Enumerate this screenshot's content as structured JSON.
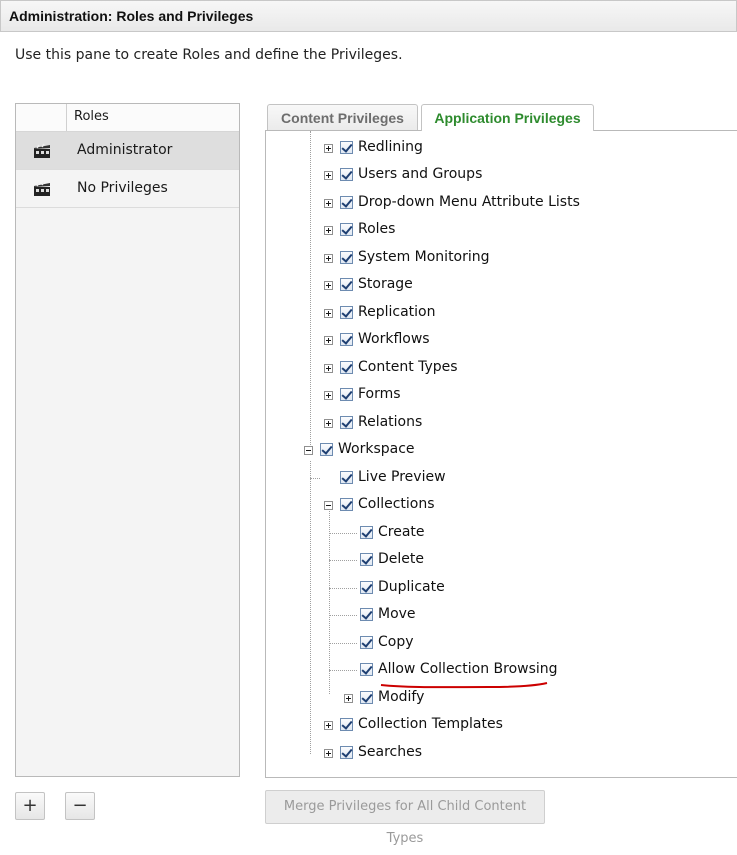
{
  "window": {
    "title": "Administration: Roles and Privileges"
  },
  "description": "Use this pane to create Roles and define the Privileges.",
  "roles": {
    "header": "Roles",
    "items": [
      {
        "label": "Administrator",
        "selected": true,
        "icon": "clapperboard-icon"
      },
      {
        "label": "No Privileges",
        "selected": false,
        "icon": "clapperboard-icon"
      }
    ]
  },
  "tabs": [
    {
      "label": "Content Privileges",
      "active": false
    },
    {
      "label": "Application Privileges",
      "active": true
    }
  ],
  "tree": {
    "items": [
      {
        "label": "Redlining",
        "level": 2,
        "expander": "plus",
        "checked": true
      },
      {
        "label": "Users and Groups",
        "level": 2,
        "expander": "plus",
        "checked": true
      },
      {
        "label": "Drop-down Menu Attribute Lists",
        "level": 2,
        "expander": "plus",
        "checked": true
      },
      {
        "label": "Roles",
        "level": 2,
        "expander": "plus",
        "checked": true
      },
      {
        "label": "System Monitoring",
        "level": 2,
        "expander": "plus",
        "checked": true
      },
      {
        "label": "Storage",
        "level": 2,
        "expander": "plus",
        "checked": true
      },
      {
        "label": "Replication",
        "level": 2,
        "expander": "plus",
        "checked": true
      },
      {
        "label": "Workflows",
        "level": 2,
        "expander": "plus",
        "checked": true
      },
      {
        "label": "Content Types",
        "level": 2,
        "expander": "plus",
        "checked": true
      },
      {
        "label": "Forms",
        "level": 2,
        "expander": "plus",
        "checked": true
      },
      {
        "label": "Relations",
        "level": 2,
        "expander": "plus",
        "checked": true
      },
      {
        "label": "Workspace",
        "level": 1,
        "expander": "minus",
        "checked": true
      },
      {
        "label": "Live Preview",
        "level": 2,
        "expander": "none",
        "checked": true
      },
      {
        "label": "Collections",
        "level": 2,
        "expander": "minus",
        "checked": true
      },
      {
        "label": "Create",
        "level": 3,
        "expander": "none",
        "checked": true
      },
      {
        "label": "Delete",
        "level": 3,
        "expander": "none",
        "checked": true
      },
      {
        "label": "Duplicate",
        "level": 3,
        "expander": "none",
        "checked": true
      },
      {
        "label": "Move",
        "level": 3,
        "expander": "none",
        "checked": true
      },
      {
        "label": "Copy",
        "level": 3,
        "expander": "none",
        "checked": true
      },
      {
        "label": "Allow Collection Browsing",
        "level": 3,
        "expander": "none",
        "checked": true,
        "highlighted": true
      },
      {
        "label": "Modify",
        "level": 3,
        "expander": "plus",
        "checked": true
      },
      {
        "label": "Collection Templates",
        "level": 2,
        "expander": "plus",
        "checked": true
      },
      {
        "label": "Searches",
        "level": 2,
        "expander": "plus",
        "checked": true
      }
    ]
  },
  "buttons": {
    "add": "+",
    "remove": "−",
    "merge": "Merge Privileges for All Child Content Types"
  },
  "colors": {
    "active_tab_text": "#2e8b2e",
    "highlight_underline": "#cc0000",
    "selected_row": "#dedede"
  }
}
